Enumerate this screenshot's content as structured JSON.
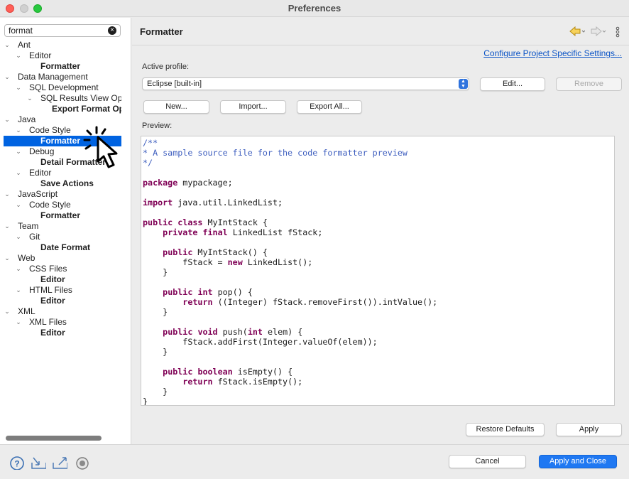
{
  "window": {
    "title": "Preferences"
  },
  "sidebar": {
    "filter": {
      "value": "format",
      "placeholder": ""
    },
    "tree": [
      {
        "label": "Ant",
        "level": 0,
        "expanded": true,
        "bold": false,
        "selected": false
      },
      {
        "label": "Editor",
        "level": 1,
        "expanded": true,
        "bold": false,
        "selected": false
      },
      {
        "label": "Formatter",
        "level": 2,
        "leaf": true,
        "bold": true,
        "selected": false
      },
      {
        "label": "Data Management",
        "level": 0,
        "expanded": true,
        "bold": false,
        "selected": false
      },
      {
        "label": "SQL Development",
        "level": 1,
        "expanded": true,
        "bold": false,
        "selected": false
      },
      {
        "label": "SQL Results View Opt",
        "level": 2,
        "expanded": true,
        "bold": false,
        "selected": false
      },
      {
        "label": "Export Format Opt",
        "level": 3,
        "leaf": true,
        "bold": true,
        "selected": false
      },
      {
        "label": "Java",
        "level": 0,
        "expanded": true,
        "bold": false,
        "selected": false
      },
      {
        "label": "Code Style",
        "level": 1,
        "expanded": true,
        "bold": false,
        "selected": false
      },
      {
        "label": "Formatter",
        "level": 2,
        "leaf": true,
        "bold": true,
        "selected": true
      },
      {
        "label": "Debug",
        "level": 1,
        "expanded": true,
        "bold": false,
        "selected": false
      },
      {
        "label": "Detail Formatters",
        "level": 2,
        "leaf": true,
        "bold": true,
        "selected": false
      },
      {
        "label": "Editor",
        "level": 1,
        "expanded": true,
        "bold": false,
        "selected": false
      },
      {
        "label": "Save Actions",
        "level": 2,
        "leaf": true,
        "bold": true,
        "selected": false
      },
      {
        "label": "JavaScript",
        "level": 0,
        "expanded": true,
        "bold": false,
        "selected": false
      },
      {
        "label": "Code Style",
        "level": 1,
        "expanded": true,
        "bold": false,
        "selected": false
      },
      {
        "label": "Formatter",
        "level": 2,
        "leaf": true,
        "bold": true,
        "selected": false
      },
      {
        "label": "Team",
        "level": 0,
        "expanded": true,
        "bold": false,
        "selected": false
      },
      {
        "label": "Git",
        "level": 1,
        "expanded": true,
        "bold": false,
        "selected": false
      },
      {
        "label": "Date Format",
        "level": 2,
        "leaf": true,
        "bold": true,
        "selected": false
      },
      {
        "label": "Web",
        "level": 0,
        "expanded": true,
        "bold": false,
        "selected": false
      },
      {
        "label": "CSS Files",
        "level": 1,
        "expanded": true,
        "bold": false,
        "selected": false
      },
      {
        "label": "Editor",
        "level": 2,
        "leaf": true,
        "bold": true,
        "selected": false
      },
      {
        "label": "HTML Files",
        "level": 1,
        "expanded": true,
        "bold": false,
        "selected": false
      },
      {
        "label": "Editor",
        "level": 2,
        "leaf": true,
        "bold": true,
        "selected": false
      },
      {
        "label": "XML",
        "level": 0,
        "expanded": true,
        "bold": false,
        "selected": false
      },
      {
        "label": "XML Files",
        "level": 1,
        "expanded": true,
        "bold": false,
        "selected": false
      },
      {
        "label": "Editor",
        "level": 2,
        "leaf": true,
        "bold": true,
        "selected": false
      }
    ]
  },
  "main": {
    "title": "Formatter",
    "configure_link": "Configure Project Specific Settings...",
    "active_profile_label": "Active profile:",
    "profile_value": "Eclipse [built-in]",
    "buttons": {
      "edit": "Edit...",
      "remove": "Remove",
      "new": "New...",
      "import": "Import...",
      "export_all": "Export All..."
    },
    "preview_label": "Preview:",
    "preview_code": [
      [
        {
          "t": "/**",
          "c": "cm"
        }
      ],
      [
        {
          "t": "* A sample source file for the code formatter preview",
          "c": "cm"
        }
      ],
      [
        {
          "t": "*/",
          "c": "cm"
        }
      ],
      [],
      [
        {
          "t": "package",
          "c": "kw"
        },
        {
          "t": " mypackage;"
        }
      ],
      [],
      [
        {
          "t": "import",
          "c": "kw"
        },
        {
          "t": " java.util.LinkedList;"
        }
      ],
      [],
      [
        {
          "t": "public",
          "c": "kw"
        },
        {
          "t": " "
        },
        {
          "t": "class",
          "c": "kw"
        },
        {
          "t": " MyIntStack {"
        }
      ],
      [
        {
          "t": "    "
        },
        {
          "t": "private",
          "c": "kw"
        },
        {
          "t": " "
        },
        {
          "t": "final",
          "c": "kw"
        },
        {
          "t": " LinkedList fStack;"
        }
      ],
      [],
      [
        {
          "t": "    "
        },
        {
          "t": "public",
          "c": "kw"
        },
        {
          "t": " MyIntStack() {"
        }
      ],
      [
        {
          "t": "        fStack = "
        },
        {
          "t": "new",
          "c": "kw"
        },
        {
          "t": " LinkedList();"
        }
      ],
      [
        {
          "t": "    }"
        }
      ],
      [],
      [
        {
          "t": "    "
        },
        {
          "t": "public",
          "c": "kw"
        },
        {
          "t": " "
        },
        {
          "t": "int",
          "c": "kw"
        },
        {
          "t": " pop() {"
        }
      ],
      [
        {
          "t": "        "
        },
        {
          "t": "return",
          "c": "kw"
        },
        {
          "t": " ((Integer) fStack.removeFirst()).intValue();"
        }
      ],
      [
        {
          "t": "    }"
        }
      ],
      [],
      [
        {
          "t": "    "
        },
        {
          "t": "public",
          "c": "kw"
        },
        {
          "t": " "
        },
        {
          "t": "void",
          "c": "kw"
        },
        {
          "t": " push("
        },
        {
          "t": "int",
          "c": "kw"
        },
        {
          "t": " elem) {"
        }
      ],
      [
        {
          "t": "        fStack.addFirst(Integer.valueOf(elem));"
        }
      ],
      [
        {
          "t": "    }"
        }
      ],
      [],
      [
        {
          "t": "    "
        },
        {
          "t": "public",
          "c": "kw"
        },
        {
          "t": " "
        },
        {
          "t": "boolean",
          "c": "kw"
        },
        {
          "t": " isEmpty() {"
        }
      ],
      [
        {
          "t": "        "
        },
        {
          "t": "return",
          "c": "kw"
        },
        {
          "t": " fStack.isEmpty();"
        }
      ],
      [
        {
          "t": "    }"
        }
      ],
      [
        {
          "t": "}"
        }
      ]
    ],
    "restore_defaults": "Restore Defaults",
    "apply": "Apply"
  },
  "footer": {
    "cancel": "Cancel",
    "apply_and_close": "Apply and Close",
    "icons": [
      "help-icon",
      "import-icon",
      "export-icon",
      "record-icon"
    ]
  },
  "colors": {
    "selection": "#0063e1",
    "link": "#0a53c6",
    "keyword": "#7f0055",
    "comment": "#3f5fbf",
    "primary_button": "#1f78f2"
  }
}
